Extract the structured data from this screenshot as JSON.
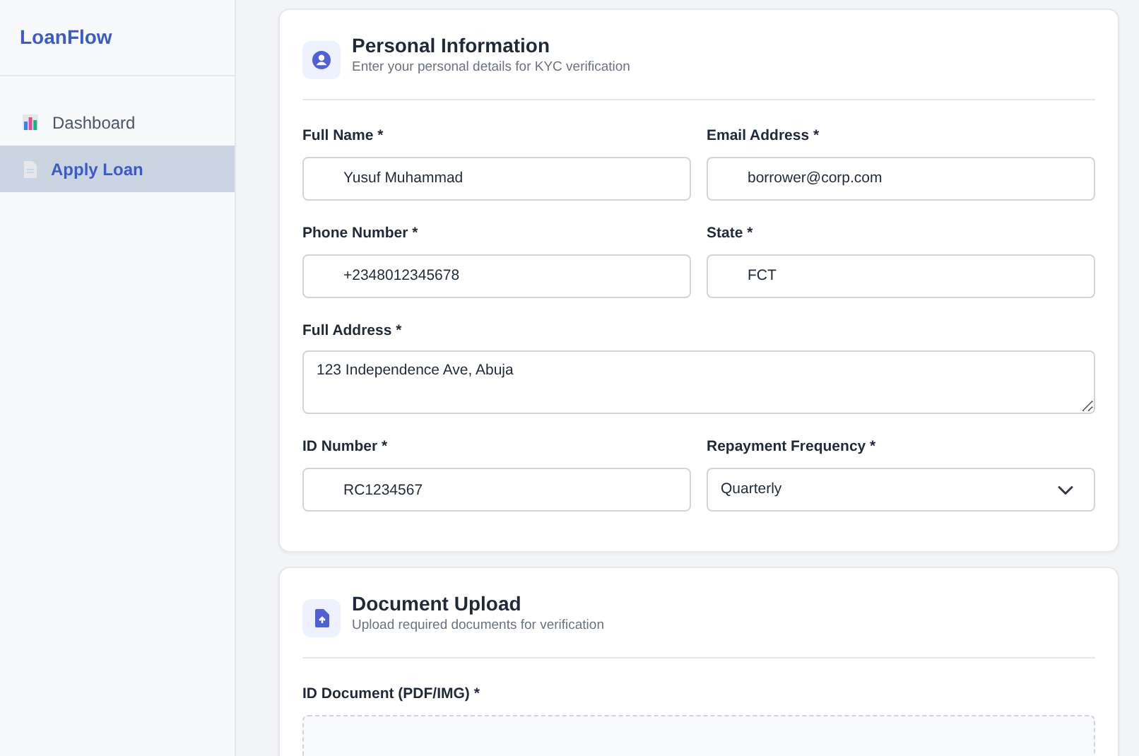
{
  "sidebar": {
    "brand": "LoanFlow",
    "items": [
      {
        "label": "Dashboard",
        "selected": false
      },
      {
        "label": "Apply Loan",
        "selected": true
      }
    ]
  },
  "sections": [
    {
      "title": "Personal Information",
      "subtitle": "Enter your personal details for KYC verification",
      "fields": [
        {
          "kind": "input",
          "label": "Full Name *",
          "value": "Yusuf Muhammad"
        },
        {
          "kind": "input",
          "label": "Email Address *",
          "value": "borrower@corp.com"
        },
        {
          "kind": "input",
          "label": "Phone Number *",
          "value": "+2348012345678"
        },
        {
          "kind": "input",
          "label": "State *",
          "value": "FCT"
        },
        {
          "kind": "textarea",
          "label": "Full Address *",
          "value": "123 Independence Ave, Abuja"
        },
        {
          "kind": "input",
          "label": "ID Number *",
          "value": "RC1234567"
        },
        {
          "kind": "select",
          "label": "Repayment Frequency *",
          "value": "Quarterly"
        }
      ]
    },
    {
      "title": "Document Upload",
      "subtitle": "Upload required documents for verification",
      "fields": [
        {
          "kind": "dropzone",
          "label": "ID Document (PDF/IMG) *"
        }
      ]
    }
  ]
}
